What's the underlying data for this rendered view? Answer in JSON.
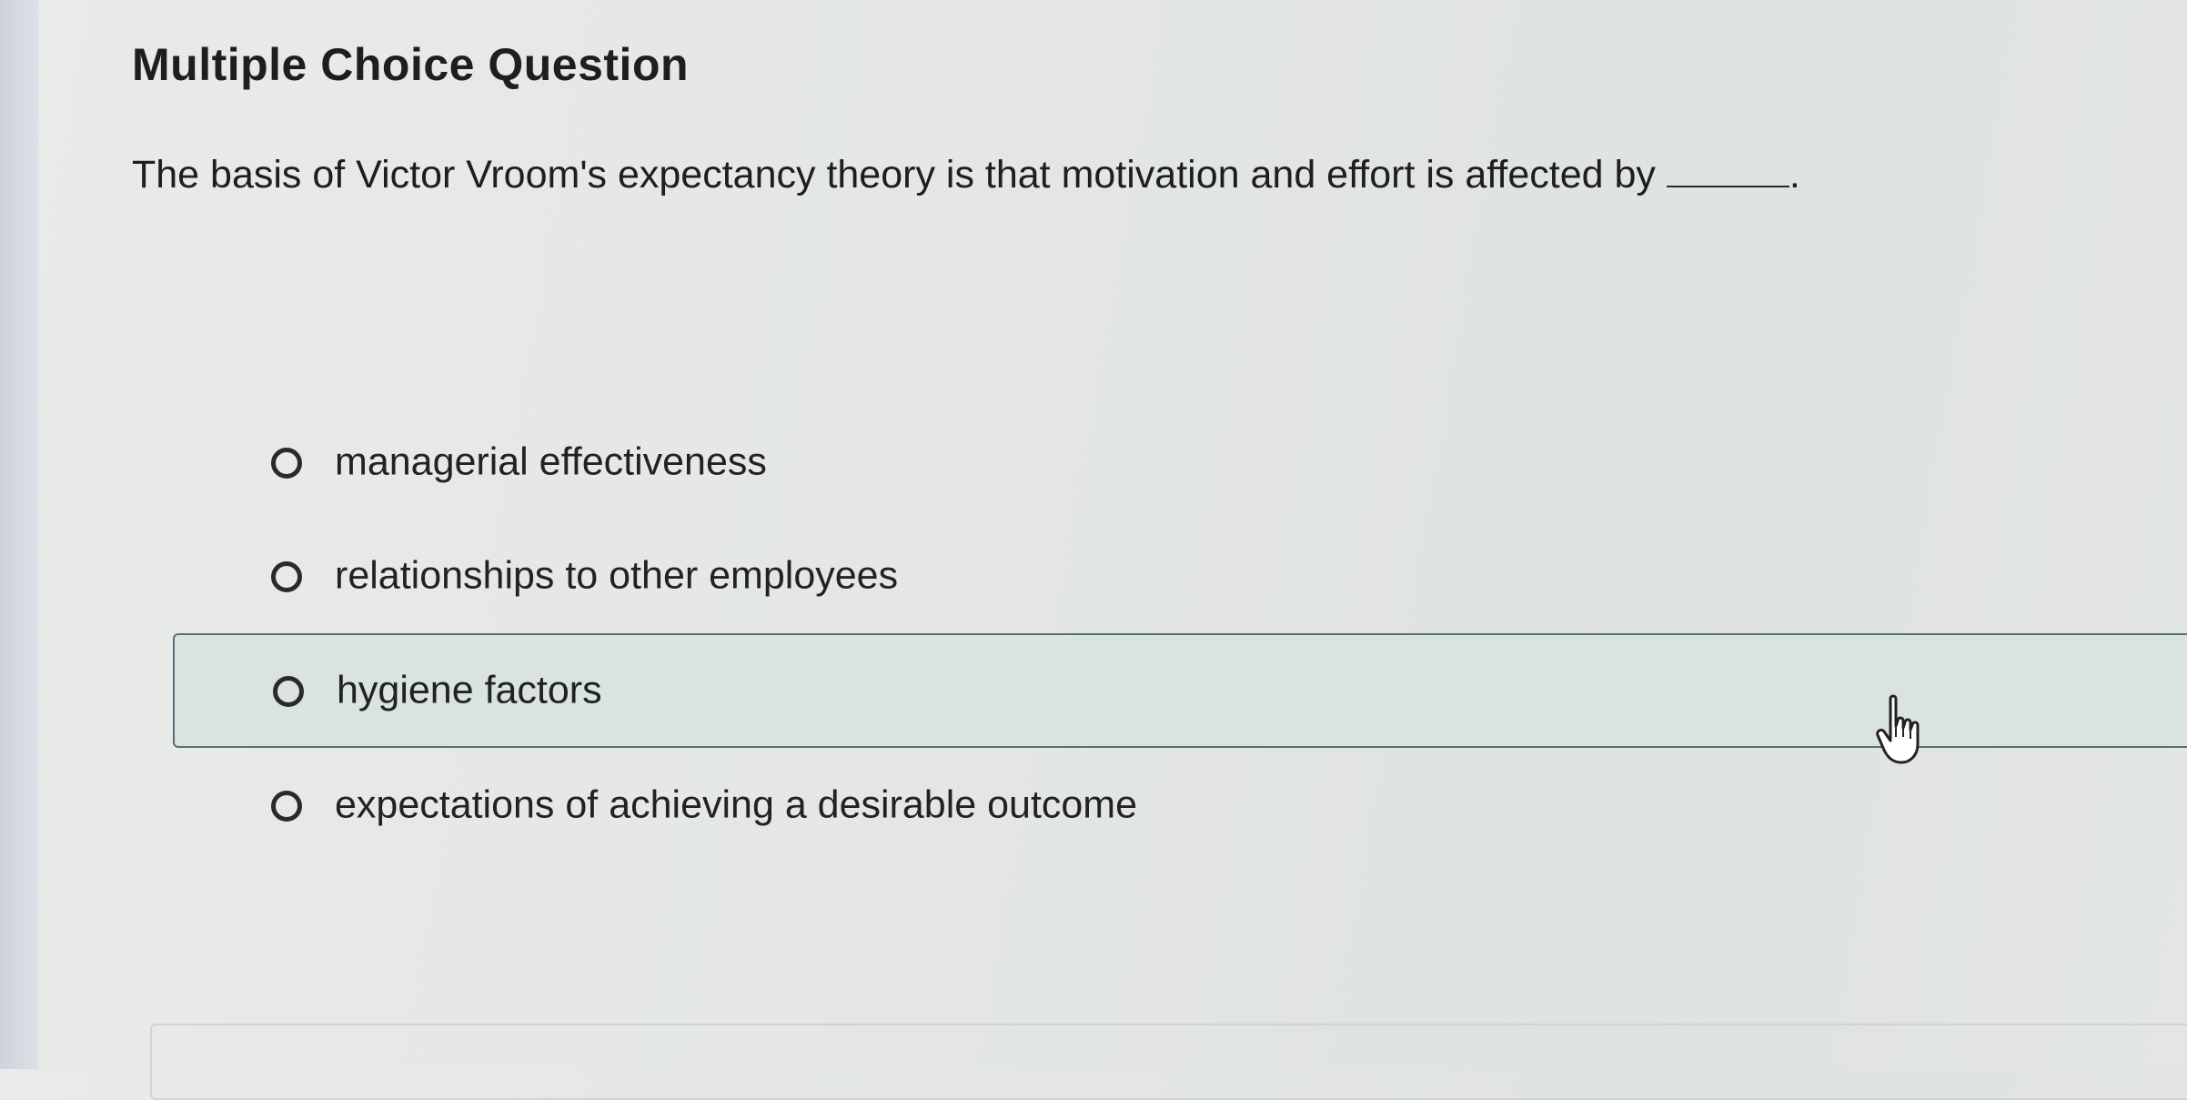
{
  "question": {
    "title": "Multiple Choice Question",
    "stem": "The basis of Victor Vroom's expectancy theory is that motivation and effort is affected by",
    "stem_end": "."
  },
  "options": [
    {
      "label": "managerial effectiveness",
      "selected": false,
      "hovered": false
    },
    {
      "label": "relationships to other employees",
      "selected": false,
      "hovered": false
    },
    {
      "label": "hygiene factors",
      "selected": false,
      "hovered": true
    },
    {
      "label": "expectations of achieving a desirable outcome",
      "selected": false,
      "hovered": false
    }
  ],
  "colors": {
    "hover_background": "#d9e3e0",
    "hover_border": "#5c6d7a",
    "text": "#1e1e1e"
  },
  "icons": {
    "option_marker": "radio-button-icon",
    "cursor": "hand-pointer-icon"
  }
}
